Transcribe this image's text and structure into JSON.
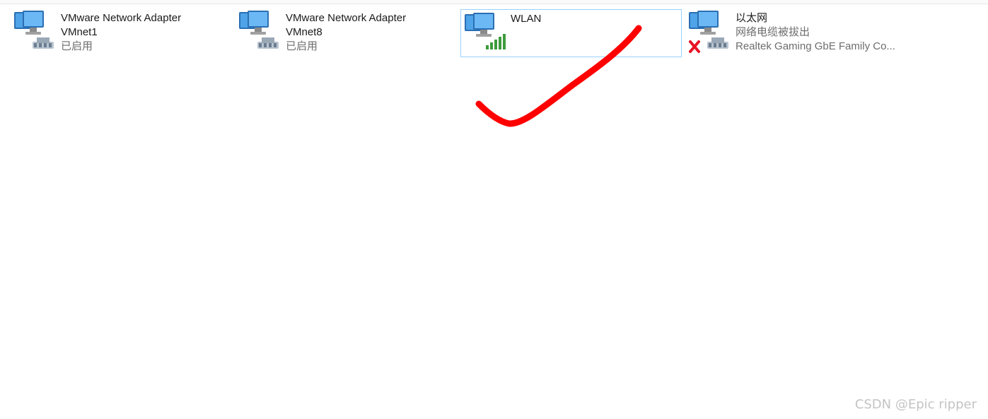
{
  "adapters": [
    {
      "name": "VMware Network Adapter",
      "device": "VMnet1",
      "status": "已启用",
      "icon": "network-cable-icon"
    },
    {
      "name": "VMware Network Adapter",
      "device": "VMnet8",
      "status": "已启用",
      "icon": "network-cable-icon"
    },
    {
      "name": "WLAN",
      "icon": "wifi-signal-icon",
      "selected": true
    },
    {
      "name": "以太网",
      "status": "网络电缆被拔出",
      "device": "Realtek Gaming GbE Family Co...",
      "icon": "network-disconnected-icon"
    }
  ],
  "annotation": {
    "icon": "checkmark-annotation",
    "color": "#ff0000"
  },
  "watermark": "CSDN @Epic ripper",
  "colors": {
    "selection_border": "#99d1ff",
    "signal_green": "#3c9b3c",
    "error_red": "#e81123"
  }
}
